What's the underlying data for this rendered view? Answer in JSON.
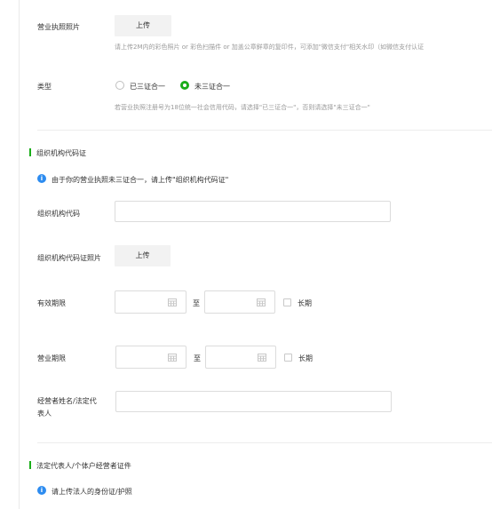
{
  "license_photo": {
    "label": "营业执照照片",
    "upload_label": "上传",
    "hint": "请上传2M内的彩色照片 or 彩色扫描件 or 加盖公章鲜章的复印件，可添加\"微信支付\"相关水印（如微信支付认证"
  },
  "type": {
    "label": "类型",
    "option_1": "已三证合一",
    "option_2": "未三证合一",
    "selected": "未三证合一",
    "hint": "若营业执照注册号为18位统一社会信用代码，请选择\"已三证合一\"，否则请选择\"未三证合一\""
  },
  "org_section": {
    "title": "组织机构代码证",
    "info": "由于你的营业执照未三证合一，请上传\"组织机构代码证\"",
    "code_label": "组织机构代码",
    "code_value": "",
    "photo_label": "组织机构代码证照片",
    "upload_label": "上传",
    "validity_label": "有效期限",
    "to_label": "至",
    "long_term_label": "长期"
  },
  "business": {
    "term_label": "营业期限",
    "to_label": "至",
    "long_term_label": "长期",
    "operator_label_line1": "经营者姓名/法定代",
    "operator_label_line2": "表人",
    "operator_value": ""
  },
  "legal_section": {
    "title": "法定代表人/个体户经营者证件",
    "info": "请上传法人的身份证/护照"
  },
  "colors": {
    "accent": "#1aad19",
    "info": "#2d8cf0"
  }
}
